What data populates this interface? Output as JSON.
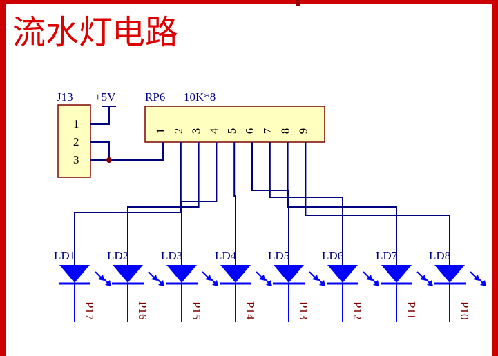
{
  "title": "流水灯电路",
  "connector": {
    "ref": "J13",
    "power": "+5V",
    "pins": [
      "1",
      "2",
      "3"
    ]
  },
  "resistor_network": {
    "ref": "RP6",
    "value": "10K*8",
    "pins": [
      "1",
      "2",
      "3",
      "4",
      "5",
      "6",
      "7",
      "8",
      "9"
    ]
  },
  "leds": [
    {
      "ref": "LD1",
      "net": "P17"
    },
    {
      "ref": "LD2",
      "net": "P16"
    },
    {
      "ref": "LD3",
      "net": "P15"
    },
    {
      "ref": "LD4",
      "net": "P14"
    },
    {
      "ref": "LD5",
      "net": "P13"
    },
    {
      "ref": "LD6",
      "net": "P12"
    },
    {
      "ref": "LD7",
      "net": "P11"
    },
    {
      "ref": "LD8",
      "net": "P10"
    }
  ],
  "colors": {
    "border": "#cc0000",
    "title": "#dd0000",
    "wire": "#000080",
    "led": "#0000ff",
    "label": "#000080",
    "net_label": "#800000",
    "component_fill": "#ffffc0",
    "component_outline": "#800000",
    "junction": "#800000"
  }
}
